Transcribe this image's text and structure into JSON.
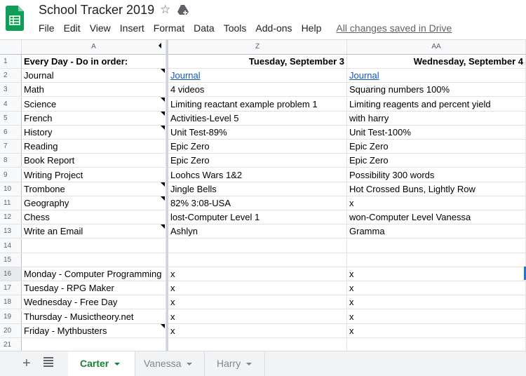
{
  "app": {
    "title": "School Tracker 2019",
    "icons": {
      "logo": "sheets-logo-icon",
      "star": "star-icon",
      "drive": "move-to-drive-icon"
    },
    "save_status": "All changes saved in Drive",
    "brand_color": "#0f9d58"
  },
  "menu": [
    "File",
    "Edit",
    "View",
    "Insert",
    "Format",
    "Data",
    "Tools",
    "Add-ons",
    "Help"
  ],
  "columns": [
    "A",
    "Z",
    "AA"
  ],
  "rows": [
    {
      "n": "1",
      "a": "Every Day - Do in order:",
      "z": "Tuesday, September 3",
      "aa": "Wednesday, September 4"
    },
    {
      "n": "2",
      "a": "Journal",
      "z": "Journal",
      "aa": "Journal"
    },
    {
      "n": "3",
      "a": "Math",
      "z": "4 videos",
      "aa": "Squaring numbers 100%"
    },
    {
      "n": "4",
      "a": "Science",
      "z": "Limiting reactant example problem 1",
      "aa": "Limiting reagents and percent yield"
    },
    {
      "n": "5",
      "a": "French",
      "z": "Activities-Level 5",
      "aa": "with harry"
    },
    {
      "n": "6",
      "a": "History",
      "z": "Unit Test-89%",
      "aa": "Unit Test-100%"
    },
    {
      "n": "7",
      "a": "Reading",
      "z": "Epic Zero",
      "aa": "Epic Zero"
    },
    {
      "n": "8",
      "a": "Book Report",
      "z": "Epic Zero",
      "aa": "Epic Zero"
    },
    {
      "n": "9",
      "a": "Writing Project",
      "z": "Loohcs Wars 1&2",
      "aa": "Possibility 300 words"
    },
    {
      "n": "10",
      "a": "Trombone",
      "z": "Jingle Bells",
      "aa": "Hot Crossed Buns, Lightly Row"
    },
    {
      "n": "11",
      "a": "Geography",
      "z": "82% 3:08-USA",
      "aa": "x"
    },
    {
      "n": "12",
      "a": "Chess",
      "z": "lost-Computer Level 1",
      "aa": "won-Computer Level Vanessa"
    },
    {
      "n": "13",
      "a": "Write an Email",
      "z": "Ashlyn",
      "aa": "Gramma"
    },
    {
      "n": "14",
      "a": "",
      "z": "",
      "aa": ""
    },
    {
      "n": "15",
      "a": "",
      "z": "",
      "aa": ""
    },
    {
      "n": "16",
      "a": "Monday - Computer Programming",
      "z": "x",
      "aa": "x"
    },
    {
      "n": "17",
      "a": "Tuesday - RPG Maker",
      "z": "x",
      "aa": "x"
    },
    {
      "n": "18",
      "a": "Wednesday - Free Day",
      "z": "x",
      "aa": "x"
    },
    {
      "n": "19",
      "a": "Thursday - Musictheory.net",
      "z": "x",
      "aa": "x"
    },
    {
      "n": "20",
      "a": "Friday - Mythbusters",
      "z": "x",
      "aa": "x"
    },
    {
      "n": "21",
      "a": "",
      "z": "",
      "aa": ""
    }
  ],
  "sheet_tabs": {
    "add_icon": "+",
    "tabs": [
      {
        "label": "Carter",
        "active": true
      },
      {
        "label": "Vanessa",
        "active": false
      },
      {
        "label": "Harry",
        "active": false
      }
    ]
  }
}
